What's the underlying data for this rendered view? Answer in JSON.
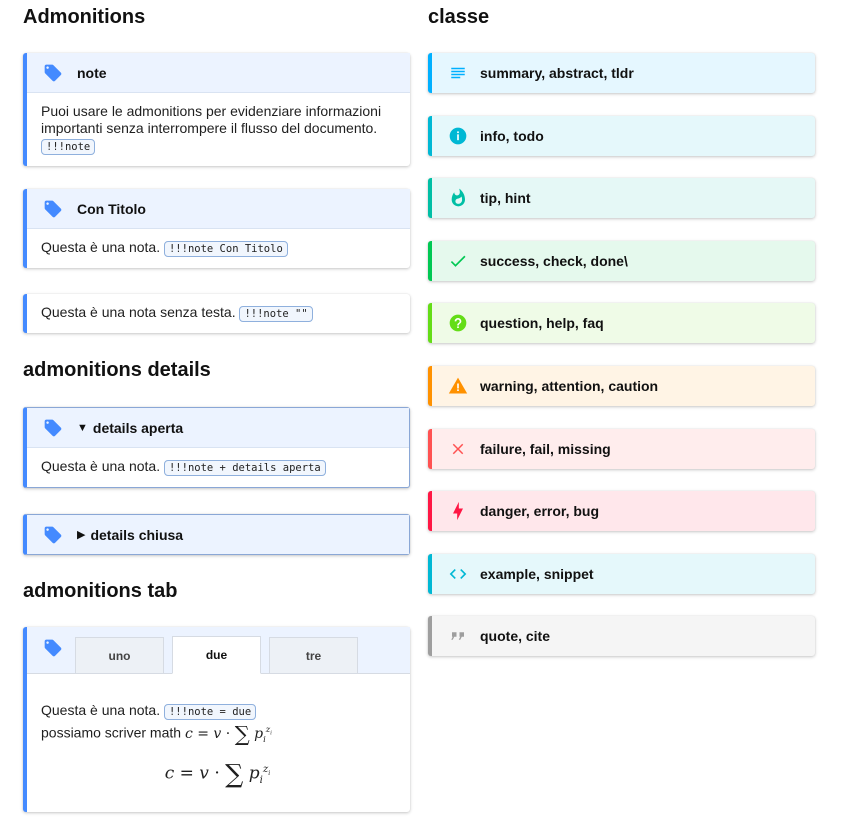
{
  "left": {
    "heading_admonitions": "Admonitions",
    "note": {
      "title": "note",
      "text": "Puoi usare le admonitions per evidenziare informazioni importanti senza interrompere il flusso del documento.",
      "code": "!!!note"
    },
    "titled": {
      "title": "Con Titolo",
      "text": "Questa è una nota.",
      "code": "!!!note Con Titolo"
    },
    "headless": {
      "text": "Questa è una nota senza testa.",
      "code": "!!!note \"\""
    },
    "heading_details": "admonitions details",
    "details_open": {
      "caret": "▼",
      "title": "details aperta",
      "text": "Questa è una nota.",
      "code": "!!!note + details aperta"
    },
    "details_closed": {
      "caret": "▶",
      "title": "details chiusa"
    },
    "heading_tab": "admonitions tab",
    "tab_box": {
      "tabs": [
        "uno",
        "due",
        "tre"
      ],
      "active_tab": "due",
      "text": "Questa è una nota.",
      "code": "!!!note = due",
      "math_prefix": "possiamo scriver math"
    }
  },
  "right": {
    "heading": "classe",
    "classes": [
      {
        "label": "summary, abstract, tldr",
        "icon": "list-lines-icon",
        "color": "#00b0ff",
        "bg": "#e5f7ff"
      },
      {
        "label": "info, todo",
        "icon": "info-circle-icon",
        "color": "#00b8d4",
        "bg": "#e5f8fb"
      },
      {
        "label": "tip, hint",
        "icon": "flame-icon",
        "color": "#00bfa5",
        "bg": "#e5f8f6"
      },
      {
        "label": "success, check, done\\",
        "icon": "check-icon",
        "color": "#00c853",
        "bg": "#e5f9ed"
      },
      {
        "label": "question, help, faq",
        "icon": "question-circle-icon",
        "color": "#64dd17",
        "bg": "#effbe7"
      },
      {
        "label": "warning, attention, caution",
        "icon": "warning-triangle-icon",
        "color": "#ff9100",
        "bg": "#fff4e5"
      },
      {
        "label": "failure, fail, missing",
        "icon": "x-icon",
        "color": "#ff5252",
        "bg": "#ffeded"
      },
      {
        "label": "danger, error, bug",
        "icon": "lightning-icon",
        "color": "#ff1744",
        "bg": "#ffe7eb"
      },
      {
        "label": "example, snippet",
        "icon": "code-brackets-icon",
        "color": "#00b8d4",
        "bg": "#e5f8fb"
      },
      {
        "label": "quote, cite",
        "icon": "quote-icon",
        "color": "#9e9e9e",
        "bg": "#f5f5f5"
      }
    ]
  },
  "colors": {
    "note_accent": "#448aff",
    "note_title_bg": "#ecf3ff"
  }
}
